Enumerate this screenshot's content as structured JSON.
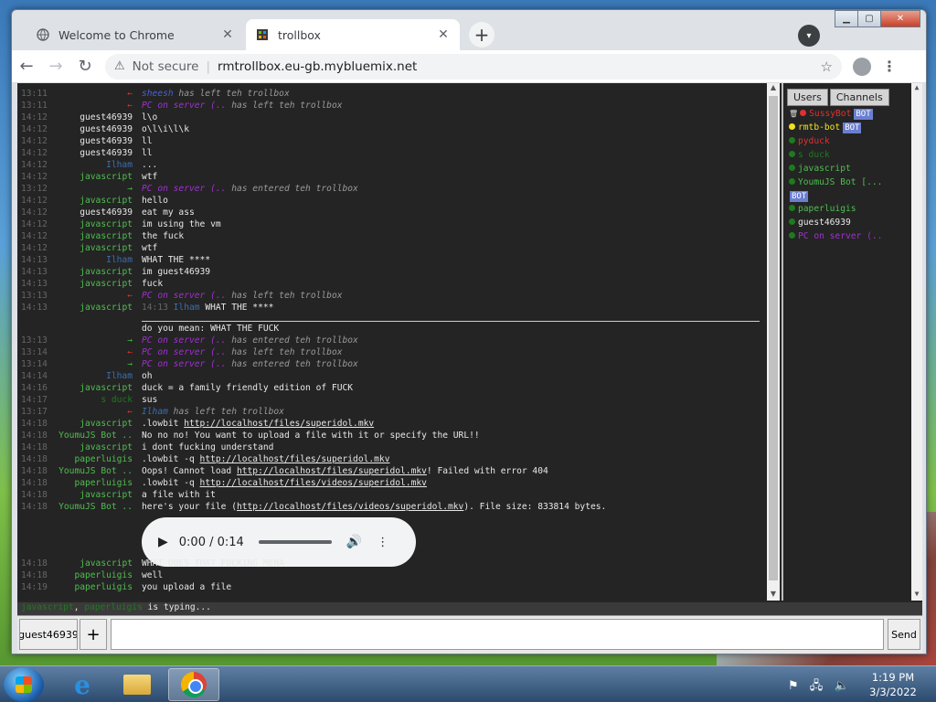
{
  "browser": {
    "tabs": [
      {
        "title": "Welcome to Chrome",
        "active": false
      },
      {
        "title": "trollbox",
        "active": true
      }
    ],
    "security": "Not secure",
    "url": "rmtrollbox.eu-gb.mybluemix.net"
  },
  "chat": {
    "messages": [
      {
        "time": "13:11",
        "nick": "",
        "arrow": "out",
        "text": "sheesh has left teh trollbox",
        "type": "sys",
        "color": "c-sheesh"
      },
      {
        "time": "13:11",
        "nick": "",
        "arrow": "out",
        "text": "PC on server (.. has left teh trollbox",
        "type": "sys",
        "color": "c-pc"
      },
      {
        "time": "14:12",
        "nick": "guest46939",
        "color": "c-guest",
        "text": "l\\o"
      },
      {
        "time": "14:12",
        "nick": "guest46939",
        "color": "c-guest",
        "text": "o\\l\\i\\l\\k"
      },
      {
        "time": "14:12",
        "nick": "guest46939",
        "color": "c-guest",
        "text": "ll"
      },
      {
        "time": "14:12",
        "nick": "guest46939",
        "color": "c-guest",
        "text": "ll"
      },
      {
        "time": "14:12",
        "nick": "Ilham",
        "color": "c-ilham",
        "text": "..."
      },
      {
        "time": "14:12",
        "nick": "javascript",
        "color": "c-js",
        "text": "wtf"
      },
      {
        "time": "13:12",
        "nick": "",
        "arrow": "in",
        "text": "PC on server (.. has entered teh trollbox",
        "type": "sys",
        "color": "c-pc"
      },
      {
        "time": "14:12",
        "nick": "javascript",
        "color": "c-js",
        "text": "hello"
      },
      {
        "time": "14:12",
        "nick": "guest46939",
        "color": "c-guest",
        "text": "eat my ass"
      },
      {
        "time": "14:12",
        "nick": "javascript",
        "color": "c-js",
        "text": "im using the vm"
      },
      {
        "time": "14:12",
        "nick": "javascript",
        "color": "c-js",
        "text": "the fuck"
      },
      {
        "time": "14:12",
        "nick": "javascript",
        "color": "c-js",
        "text": "wtf"
      },
      {
        "time": "14:13",
        "nick": "Ilham",
        "color": "c-ilham",
        "text": "WHAT THE ****"
      },
      {
        "time": "14:13",
        "nick": "javascript",
        "color": "c-js",
        "text": "im guest46939"
      },
      {
        "time": "14:13",
        "nick": "javascript",
        "color": "c-js",
        "text": "fuck"
      },
      {
        "time": "13:13",
        "nick": "",
        "arrow": "out",
        "text": "PC on server (.. has left teh trollbox",
        "type": "sys",
        "color": "c-pc"
      },
      {
        "time": "14:13",
        "nick": "javascript",
        "color": "c-js",
        "text": "14:13           Ilham WHAT THE ****",
        "type": "quote"
      },
      {
        "time": "",
        "nick": "",
        "color": "c-guest",
        "text": "do you mean: WHAT THE FUCK"
      },
      {
        "time": "13:13",
        "nick": "",
        "arrow": "in",
        "text": "PC on server (.. has entered teh trollbox",
        "type": "sys",
        "color": "c-pc"
      },
      {
        "time": "13:14",
        "nick": "",
        "arrow": "out",
        "text": "PC on server (.. has left teh trollbox",
        "type": "sys",
        "color": "c-pc"
      },
      {
        "time": "13:14",
        "nick": "",
        "arrow": "in",
        "text": "PC on server (.. has entered teh trollbox",
        "type": "sys",
        "color": "c-pc"
      },
      {
        "time": "14:14",
        "nick": "Ilham",
        "color": "c-ilham",
        "text": "oh"
      },
      {
        "time": "14:16",
        "nick": "javascript",
        "color": "c-js",
        "text": "duck = a family friendly edition of FUCK"
      },
      {
        "time": "14:17",
        "nick": "s duck",
        "color": "c-sduck",
        "text": "sus"
      },
      {
        "time": "13:17",
        "nick": "",
        "arrow": "out",
        "text": "Ilham has left teh trollbox",
        "type": "sys",
        "color": "c-ilham"
      },
      {
        "time": "14:18",
        "nick": "javascript",
        "color": "c-js",
        "text": ".lowbit ",
        "link": "http://localhost/files/superidol.mkv",
        "after": ""
      },
      {
        "time": "14:18",
        "nick": "YoumuJS Bot ..",
        "color": "c-yj",
        "text": "No no no! You want to upload a file with it or specify the URL!!"
      },
      {
        "time": "14:18",
        "nick": "javascript",
        "color": "c-js",
        "text": "i dont fucking understand"
      },
      {
        "time": "14:18",
        "nick": "paperluigis",
        "color": "c-pl",
        "text": ".lowbit -q ",
        "link": "http://localhost/files/superidol.mkv",
        "after": ""
      },
      {
        "time": "14:18",
        "nick": "YoumuJS Bot ..",
        "color": "c-yj",
        "text": "Oops! Cannot load ",
        "link": "http://localhost/files/superidol.mkv",
        "after": "! Failed with error 404"
      },
      {
        "time": "14:18",
        "nick": "paperluigis",
        "color": "c-pl",
        "text": ".lowbit -q ",
        "link": "http://localhost/files/videos/superidol.mkv",
        "after": ""
      },
      {
        "time": "14:18",
        "nick": "javascript",
        "color": "c-js",
        "text": "a file with it"
      },
      {
        "time": "14:18",
        "nick": "YoumuJS Bot ..",
        "color": "c-yj",
        "text": "here's your file (",
        "link": "http://localhost/files/videos/superidol.mkv",
        "after": "). File size: 833814 bytes."
      }
    ],
    "messages_after_audio": [
      {
        "time": "14:18",
        "nick": "javascript",
        "color": "c-js",
        "text": "WHAT DOES THAT FUCKING MENA"
      },
      {
        "time": "14:18",
        "nick": "paperluigis",
        "color": "c-pl",
        "text": "well"
      },
      {
        "time": "14:19",
        "nick": "paperluigis",
        "color": "c-pl",
        "text": "you upload a file"
      }
    ],
    "audio": {
      "time": "0:00 / 0:14",
      "progress": 0
    },
    "typing": {
      "users": [
        "javascript",
        "paperluigis"
      ],
      "suffix": " is typing..."
    }
  },
  "sidebar": {
    "tabs": [
      "Users",
      "Channels"
    ],
    "users": [
      {
        "name": "SussyBot",
        "dot": "#e03030",
        "color": "#e03030",
        "bot": true,
        "icon": "trash-icon"
      },
      {
        "name": "rmtb-bot",
        "dot": "#f0e020",
        "color": "#f0e020",
        "bot": true
      },
      {
        "name": "pyduck",
        "dot": "#1e7a1e",
        "color": "#e03030",
        "bot": false
      },
      {
        "name": "s duck",
        "dot": "#1e7a1e",
        "color": "#1e7a1e",
        "bot": false
      },
      {
        "name": "javascript",
        "dot": "#1e7a1e",
        "color": "#4fbf4f",
        "bot": false
      },
      {
        "name": "YoumuJS Bot [...",
        "dot": "#1e7a1e",
        "color": "#4fbf4f",
        "bot": true,
        "bot_wrap": true
      },
      {
        "name": "paperluigis",
        "dot": "#1e7a1e",
        "color": "#4fbf4f",
        "bot": false
      },
      {
        "name": "guest46939",
        "dot": "#1e7a1e",
        "color": "#e8e8e8",
        "bot": false
      },
      {
        "name": "PC on server (..",
        "dot": "#1e7a1e",
        "color": "#a030d0",
        "bot": false
      }
    ],
    "bot_label": "BOT"
  },
  "input": {
    "nick": "guest46939",
    "plus": "+",
    "value": "",
    "send": "Send"
  },
  "taskbar": {
    "time": "1:19 PM",
    "date": "3/3/2022"
  }
}
